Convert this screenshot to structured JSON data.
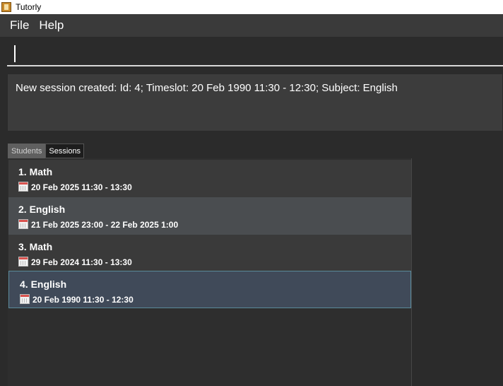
{
  "window": {
    "title": "Tutorly"
  },
  "menu": {
    "file": "File",
    "help": "Help"
  },
  "command": {
    "value": ""
  },
  "result": {
    "message": "New session created: Id: 4; Timeslot: 20 Feb 1990 11:30 - 12:30; Subject: English"
  },
  "tabs": {
    "students": "Students",
    "sessions": "Sessions",
    "active": "Sessions"
  },
  "sessions": [
    {
      "title": "1. Math",
      "timeslot": "20 Feb 2025 11:30 - 13:30"
    },
    {
      "title": "2. English",
      "timeslot": "21 Feb 2025 23:00 - 22 Feb 2025 1:00"
    },
    {
      "title": "3. Math",
      "timeslot": "29 Feb 2024 11:30 - 13:30"
    },
    {
      "title": "4. English",
      "timeslot": "20 Feb 1990 11:30 - 12:30",
      "selected": true
    }
  ],
  "colors": {
    "background": "#2b2b2b",
    "selection": "#404a59",
    "selection_border": "#5a8a9a"
  }
}
